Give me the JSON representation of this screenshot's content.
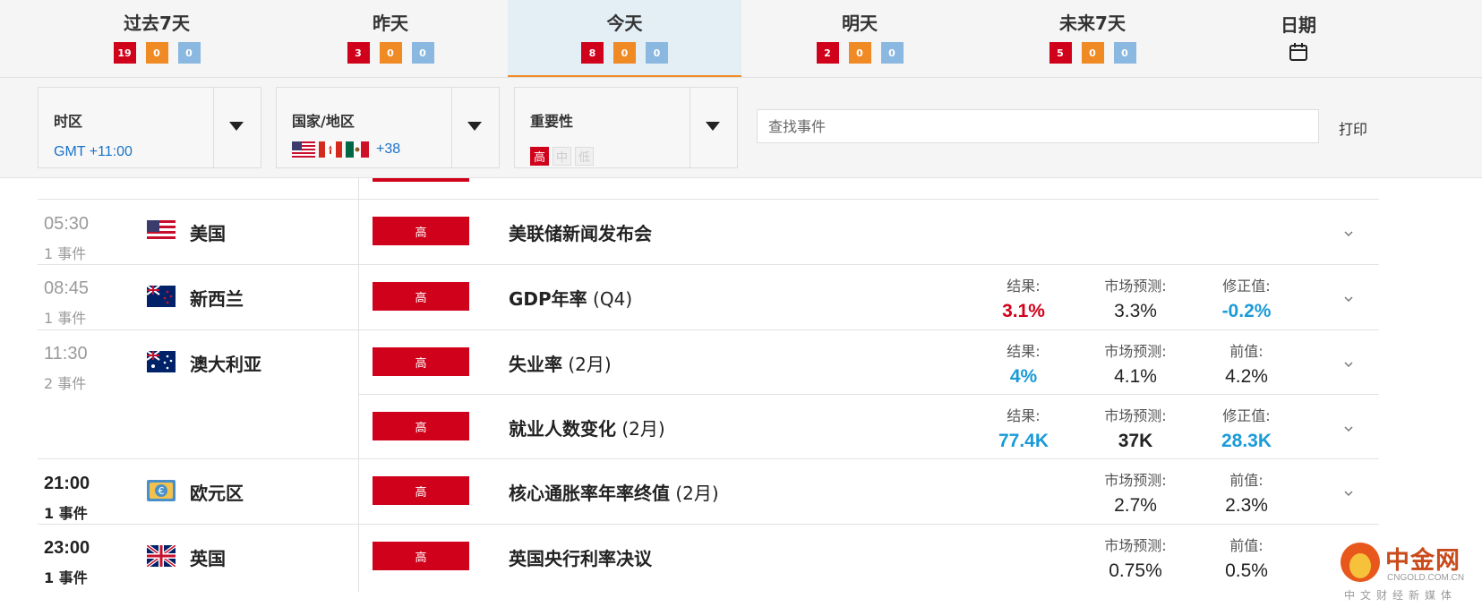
{
  "tabs": [
    {
      "label": "过去7天",
      "counts": [
        "19",
        "0",
        "0"
      ]
    },
    {
      "label": "昨天",
      "counts": [
        "3",
        "0",
        "0"
      ]
    },
    {
      "label": "今天",
      "counts": [
        "8",
        "0",
        "0"
      ]
    },
    {
      "label": "明天",
      "counts": [
        "2",
        "0",
        "0"
      ]
    },
    {
      "label": "未来7天",
      "counts": [
        "5",
        "0",
        "0"
      ]
    },
    {
      "label": "日期"
    }
  ],
  "active_tab": "今天",
  "filters": {
    "timezone": {
      "label": "时区",
      "value": "GMT +11:00"
    },
    "country": {
      "label": "国家/地区",
      "more": "+38"
    },
    "importance": {
      "label": "重要性",
      "levels": [
        "高",
        "中",
        "低"
      ]
    }
  },
  "search": {
    "placeholder": "查找事件"
  },
  "print_label": "打印",
  "rows": [
    {
      "time": "05:30",
      "count": "1 事件",
      "country": "美国",
      "impact": "高",
      "event": "美联储新闻发布会",
      "period": ""
    },
    {
      "time": "08:45",
      "count": "1 事件",
      "country": "新西兰",
      "impact": "高",
      "event": "GDP年率",
      "period": "(Q4)",
      "metrics": [
        {
          "label": "结果:",
          "value": "3.1%"
        },
        {
          "label": "市场预测:",
          "value": "3.3%"
        },
        {
          "label": "修正值:",
          "value": "-0.2%"
        }
      ]
    },
    {
      "time": "11:30",
      "count": "2 事件",
      "country": "澳大利亚",
      "impact": "高",
      "event": "失业率",
      "period": "(2月)",
      "metrics": [
        {
          "label": "结果:",
          "value": "4%"
        },
        {
          "label": "市场预测:",
          "value": "4.1%"
        },
        {
          "label": "前值:",
          "value": "4.2%"
        }
      ]
    },
    {
      "impact": "高",
      "event": "就业人数变化",
      "period": "(2月)",
      "metrics": [
        {
          "label": "结果:",
          "value": "77.4K"
        },
        {
          "label": "市场预测:",
          "value": "37K"
        },
        {
          "label": "修正值:",
          "value": "28.3K"
        }
      ]
    },
    {
      "time": "21:00",
      "count": "1 事件",
      "country": "欧元区",
      "impact": "高",
      "event": "核心通胀率年率终值",
      "period": "(2月)",
      "metrics": [
        {
          "label": "市场预测:",
          "value": "2.7%"
        },
        {
          "label": "前值:",
          "value": "2.3%"
        }
      ]
    },
    {
      "time": "23:00",
      "count": "1 事件",
      "country": "英国",
      "impact": "高",
      "event": "英国央行利率决议",
      "period": "",
      "metrics": [
        {
          "label": "市场预测:",
          "value": "0.75%"
        },
        {
          "label": "前值:",
          "value": "0.5%"
        }
      ]
    }
  ],
  "watermark": {
    "title": "中金网",
    "url": "CNGOLD.COM.CN",
    "slogan": "中文财经新媒体"
  },
  "colors": {
    "high": "#d0021b",
    "medium": "#f08a24",
    "low": "#8ab8e0",
    "link": "#1a73c8",
    "positive": "#1a9bd8"
  }
}
